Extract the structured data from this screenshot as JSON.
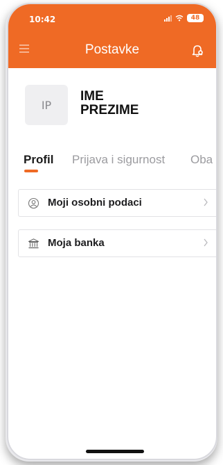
{
  "status_bar": {
    "time": "10:42",
    "battery": "48"
  },
  "header": {
    "title": "Postavke",
    "menu_icon": "hamburger-icon",
    "bell_icon": "bell-icon"
  },
  "profile": {
    "avatar_initials": "IP",
    "first_name": "IME",
    "last_name": "PREZIME"
  },
  "tabs": [
    {
      "label": "Profil",
      "active": true
    },
    {
      "label": "Prijava i sigurnost",
      "active": false
    },
    {
      "label": "Oba",
      "active": false
    }
  ],
  "menu_items": [
    {
      "label": "Moji osobni podaci",
      "icon": "user-circle-icon"
    },
    {
      "label": "Moja banka",
      "icon": "bank-icon"
    }
  ],
  "colors": {
    "accent": "#ef6a25",
    "text": "#1d1d1f",
    "muted": "#9b9b9f"
  }
}
